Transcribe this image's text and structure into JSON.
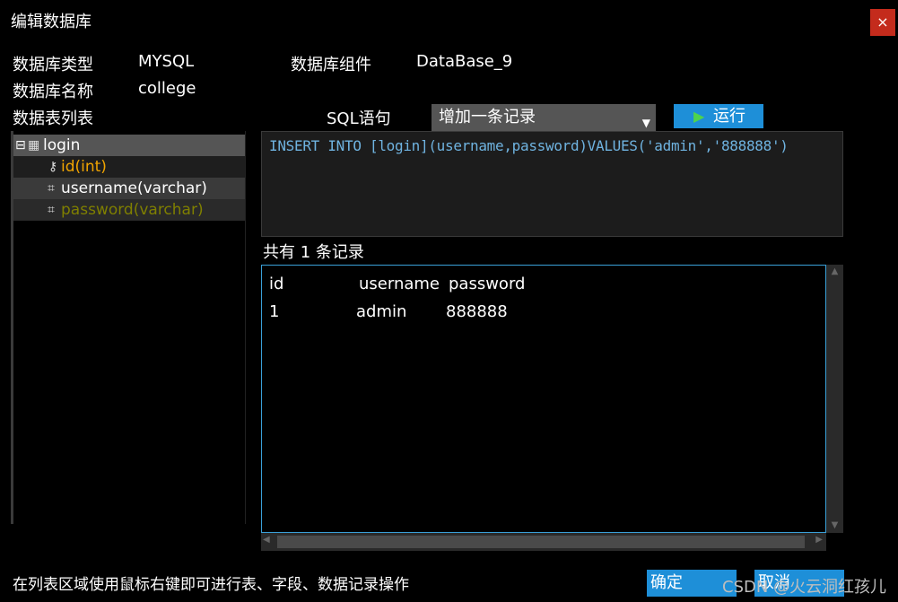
{
  "window": {
    "title": "编辑数据库",
    "close_glyph": "×"
  },
  "fields": {
    "db_type_label": "数据库类型",
    "db_type_value": "MYSQL",
    "db_component_label": "数据库组件",
    "db_component_value": "DataBase_9",
    "db_name_label": "数据库名称",
    "db_name_value": "college",
    "table_list_label": "数据表列表",
    "sql_label": "SQL语句"
  },
  "sql_select": {
    "selected": "增加一条记录"
  },
  "run_button": {
    "label": "运行"
  },
  "tree": {
    "table": {
      "label": "login",
      "expander": "⊟"
    },
    "columns": [
      {
        "label": "id(int)",
        "color": "#f0a400"
      },
      {
        "label": "username(varchar)",
        "color": "#ffffff"
      },
      {
        "label": "password(varchar)",
        "color": "#7f7f00"
      }
    ]
  },
  "sql_text": "INSERT INTO [login](username,password)VALUES('admin','888888')",
  "result": {
    "summary": "共有 1 条记录",
    "columns": [
      "id",
      "username",
      "password"
    ],
    "rows": [
      [
        "1",
        "admin",
        "888888"
      ]
    ]
  },
  "footer": {
    "hint": "在列表区域使用鼠标右键即可进行表、字段、数据记录操作",
    "ok_label": "确定",
    "cancel_label": "取消"
  },
  "watermark": "CSDN @火云洞红孩儿",
  "colors": {
    "accent": "#1e8fd8",
    "close": "#c42b1c",
    "sql_text": "#6fb3e0"
  }
}
